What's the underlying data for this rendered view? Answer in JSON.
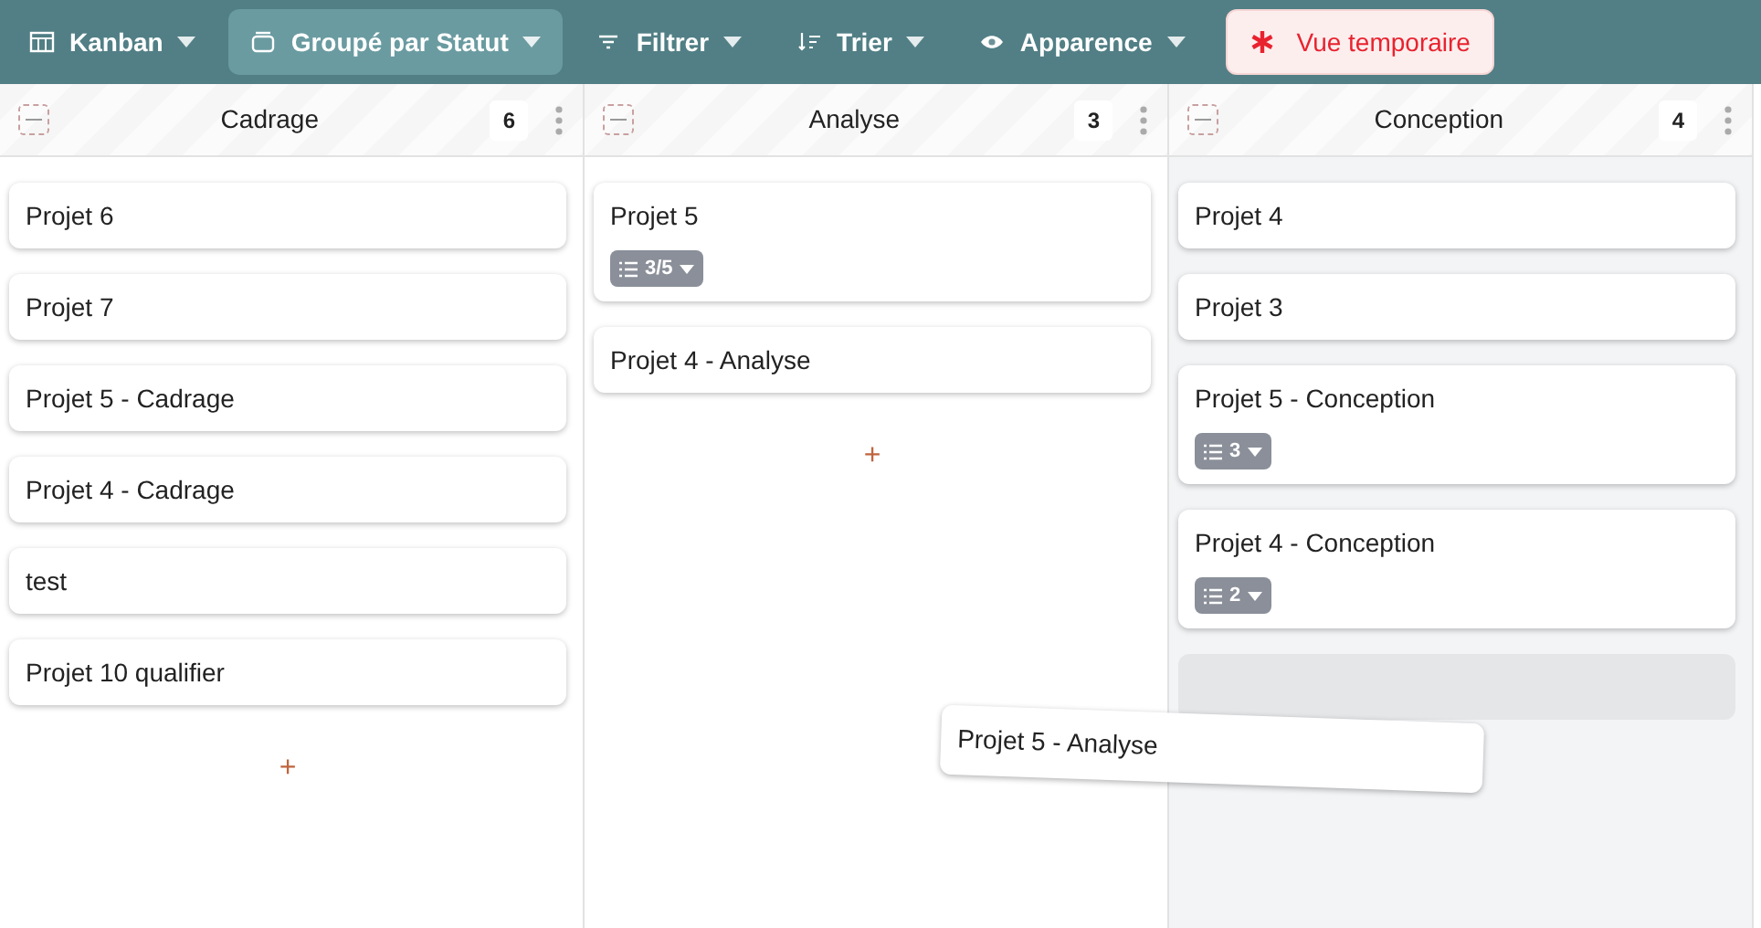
{
  "toolbar": [
    {
      "kind": "dropdown",
      "label": "Kanban",
      "selected": false
    },
    {
      "kind": "dropdown",
      "label": "Groupé par Statut",
      "selected": true
    },
    {
      "kind": "dropdown",
      "label": "Filtrer",
      "selected": false
    },
    {
      "kind": "dropdown",
      "label": "Trier",
      "selected": false
    },
    {
      "kind": "dropdown",
      "label": "Apparence",
      "selected": false
    },
    {
      "kind": "alert",
      "label": "Vue temporaire"
    }
  ],
  "columns": [
    {
      "title": "Cadrage",
      "count": "6",
      "drop_target": false,
      "add": "+",
      "cards": [
        {
          "title": "Projet 6"
        },
        {
          "title": "Projet 7"
        },
        {
          "title": "Projet 5 - Cadrage"
        },
        {
          "title": "Projet 4 - Cadrage"
        },
        {
          "title": "test"
        },
        {
          "title": "Projet 10 qualifier"
        }
      ]
    },
    {
      "title": "Analyse",
      "count": "3",
      "drop_target": false,
      "add": "+",
      "cards": [
        {
          "title": "Projet 5",
          "subtasks": "3/5"
        },
        {
          "title": "Projet 4 - Analyse"
        }
      ]
    },
    {
      "title": "Conception",
      "count": "4",
      "drop_target": true,
      "cards": [
        {
          "title": "Projet 4"
        },
        {
          "title": "Projet 3"
        },
        {
          "title": "Projet 5 - Conception",
          "subtasks": "3"
        },
        {
          "title": "Projet 4 - Conception",
          "subtasks": "2"
        }
      ]
    }
  ],
  "dragged_card": {
    "title": "Projet 5 - Analyse"
  }
}
